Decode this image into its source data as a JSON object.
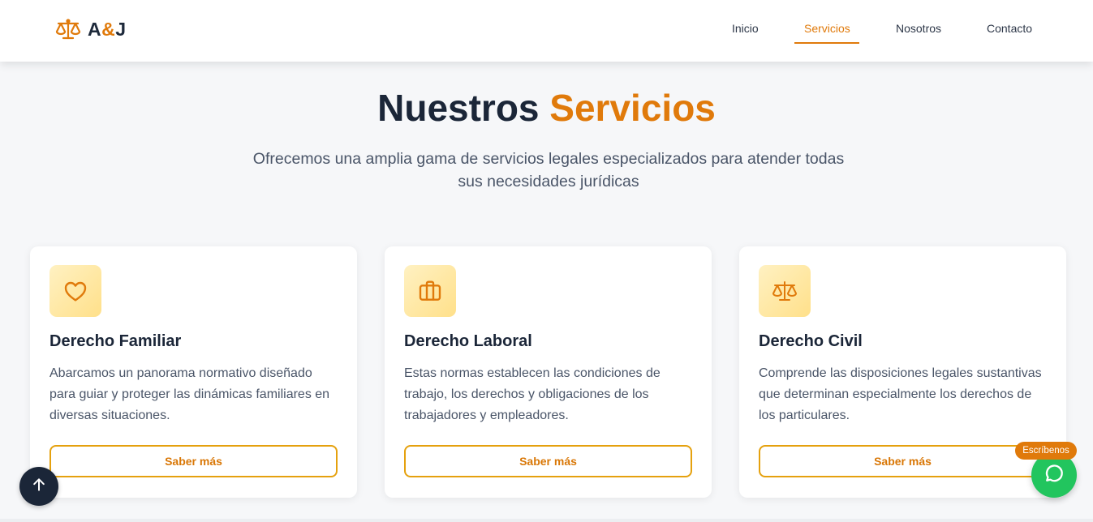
{
  "brand": {
    "letter_a": "A",
    "ampersand": "&",
    "letter_j": "J",
    "icon": "scales-icon"
  },
  "nav": {
    "items": [
      {
        "label": "Inicio",
        "active": false
      },
      {
        "label": "Servicios",
        "active": true
      },
      {
        "label": "Nosotros",
        "active": false
      },
      {
        "label": "Contacto",
        "active": false
      }
    ]
  },
  "hero": {
    "title_main": "Nuestros",
    "title_accent": "Servicios",
    "subtitle": "Ofrecemos una amplia gama de servicios legales especializados para atender todas sus necesidades jurídicas"
  },
  "cards": [
    {
      "icon": "heart-icon",
      "title": "Derecho Familiar",
      "description": "Abarcamos un panorama normativo diseñado para guiar y proteger las dinámicas familiares en diversas situaciones.",
      "button": "Saber más"
    },
    {
      "icon": "briefcase-icon",
      "title": "Derecho Laboral",
      "description": "Estas normas establecen las condiciones de trabajo, los derechos y obligaciones de los trabajadores y empleadores.",
      "button": "Saber más"
    },
    {
      "icon": "scales-icon",
      "title": "Derecho Civil",
      "description": "Comprende las disposiciones legales sustantivas que determinan especialmente los derechos de los particulares.",
      "button": "Saber más"
    }
  ],
  "floating": {
    "chat_badge": "Escríbenos",
    "chat_icon": "chat-bubble-icon",
    "scroll_icon": "arrow-up-icon"
  },
  "colors": {
    "accent": "#e07a0b",
    "dark": "#1b2638",
    "button_border": "#e5a10e",
    "chat_green": "#22c55e"
  }
}
